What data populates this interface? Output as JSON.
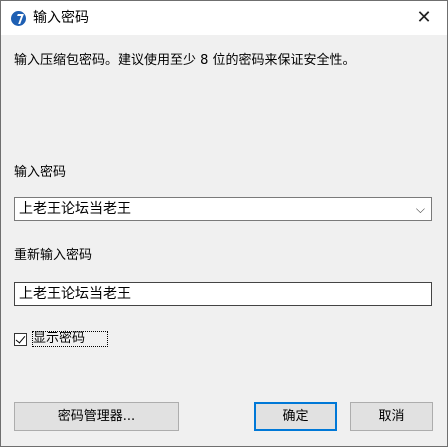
{
  "window": {
    "title": "输入密码",
    "close_glyph": "✕"
  },
  "description": "输入压缩包密码。建议使用至少 8 位的密码来保证安全性。",
  "password": {
    "label": "输入密码",
    "value": "上老王论坛当老王"
  },
  "confirm_password": {
    "label": "重新输入密码",
    "value": "上老王论坛当老王"
  },
  "show_password": {
    "label": "显示密码",
    "checked": true
  },
  "buttons": {
    "manager": "密码管理器...",
    "ok": "确定",
    "cancel": "取消"
  },
  "colors": {
    "accent": "#0078d7",
    "app_icon": "#1e5fb3"
  }
}
